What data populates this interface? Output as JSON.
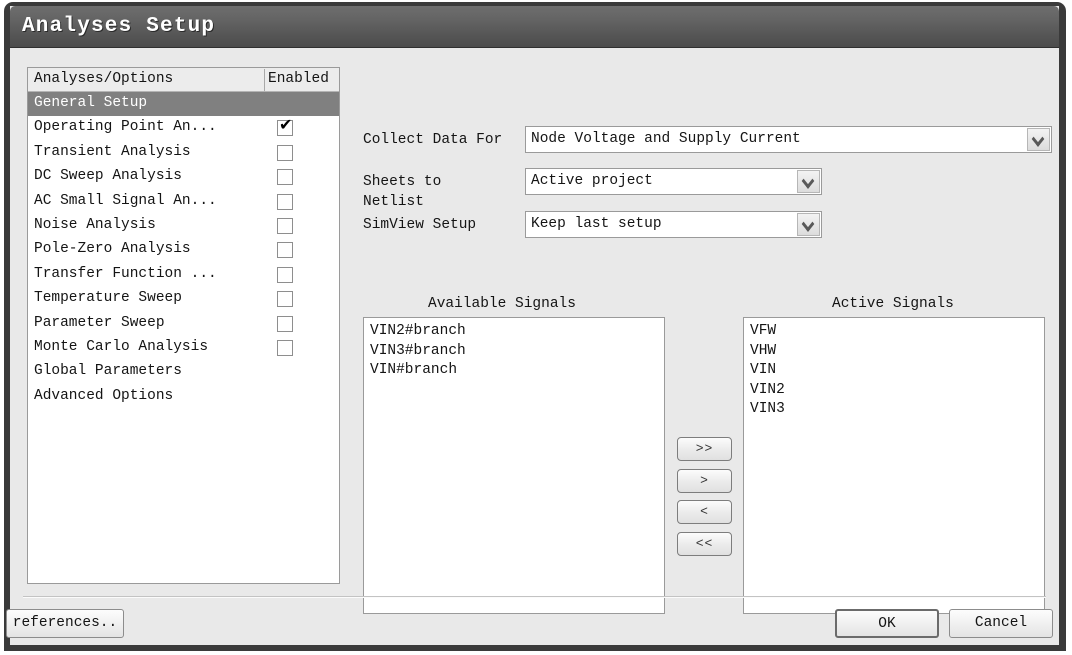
{
  "window": {
    "title": "Analyses Setup"
  },
  "analyses_table": {
    "headers": {
      "name": "Analyses/Options",
      "enabled": "Enabled"
    },
    "rows": [
      {
        "label": "General Setup",
        "selected": true,
        "has_checkbox": false,
        "checked": false
      },
      {
        "label": "Operating Point An...",
        "selected": false,
        "has_checkbox": true,
        "checked": true
      },
      {
        "label": "Transient Analysis",
        "selected": false,
        "has_checkbox": true,
        "checked": false
      },
      {
        "label": "DC Sweep Analysis",
        "selected": false,
        "has_checkbox": true,
        "checked": false
      },
      {
        "label": "AC Small Signal An...",
        "selected": false,
        "has_checkbox": true,
        "checked": false
      },
      {
        "label": "Noise Analysis",
        "selected": false,
        "has_checkbox": true,
        "checked": false
      },
      {
        "label": "Pole-Zero Analysis",
        "selected": false,
        "has_checkbox": true,
        "checked": false
      },
      {
        "label": "Transfer Function ...",
        "selected": false,
        "has_checkbox": true,
        "checked": false
      },
      {
        "label": "Temperature Sweep",
        "selected": false,
        "has_checkbox": true,
        "checked": false
      },
      {
        "label": "Parameter Sweep",
        "selected": false,
        "has_checkbox": true,
        "checked": false
      },
      {
        "label": "Monte Carlo Analysis",
        "selected": false,
        "has_checkbox": true,
        "checked": false
      },
      {
        "label": "Global Parameters",
        "selected": false,
        "has_checkbox": false,
        "checked": false
      },
      {
        "label": "Advanced Options",
        "selected": false,
        "has_checkbox": false,
        "checked": false
      }
    ]
  },
  "form": {
    "collect_data_for": {
      "label": "Collect Data For",
      "value": "Node Voltage and Supply Current"
    },
    "sheets_to_netlist": {
      "label_line1": "Sheets to",
      "label_line2": "Netlist",
      "value": "Active project"
    },
    "simview_setup": {
      "label": "SimView Setup",
      "value": "Keep last setup"
    }
  },
  "signals": {
    "available": {
      "title": "Available Signals",
      "items": [
        "VIN2#branch",
        "VIN3#branch",
        "VIN#branch"
      ]
    },
    "active": {
      "title": "Active Signals",
      "items": [
        "VFW",
        "VHW",
        "VIN",
        "VIN2",
        "VIN3"
      ]
    },
    "transfer_buttons": [
      {
        "label": ">>",
        "name": "move-all-right-button"
      },
      {
        "label": ">",
        "name": "move-right-button"
      },
      {
        "label": "<",
        "name": "move-left-button"
      },
      {
        "label": "<<",
        "name": "move-all-left-button"
      }
    ]
  },
  "footer": {
    "preferences_label": "references..",
    "ok_label": "OK",
    "cancel_label": "Cancel"
  }
}
